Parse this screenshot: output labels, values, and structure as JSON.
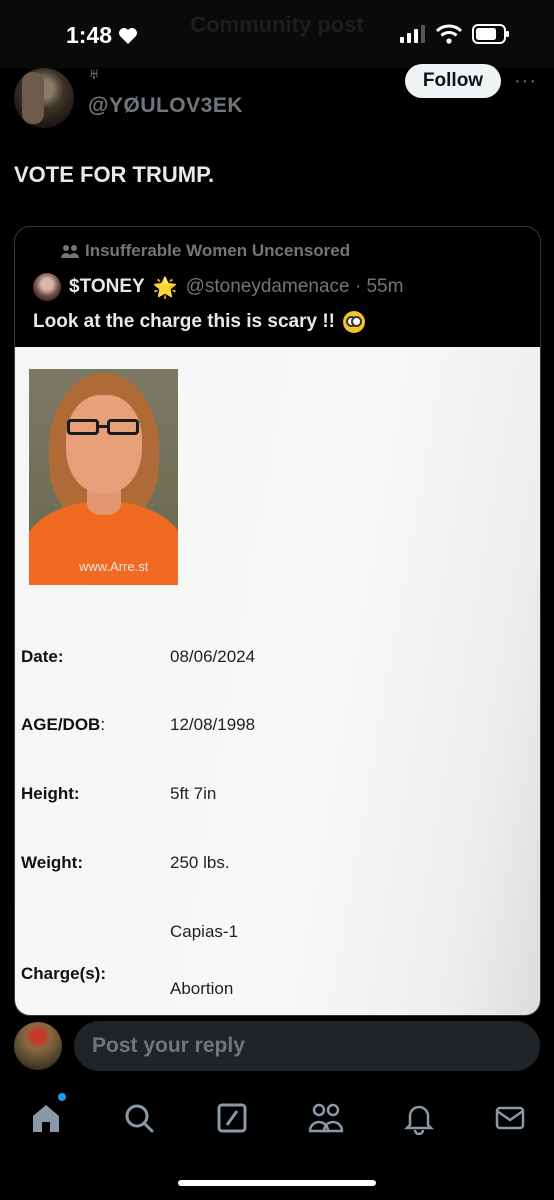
{
  "status_bar": {
    "time": "1:48",
    "ghost_title": "Community post"
  },
  "post": {
    "symbol": "♅",
    "handle": "@YØULOV3EK",
    "follow_label": "Follow",
    "more_label": "···",
    "text": "VOTE FOR TRUMP."
  },
  "quote": {
    "community": "Insufferable Women Uncensored",
    "display_name": "$TONEY",
    "star_emoji": "🌟",
    "username_time": "@stoneydamenace · 55m",
    "text": "Look at the charge this is scary !!",
    "media": {
      "watermark": "www.Arre.st",
      "rows": [
        {
          "label": "Date",
          "colon": ":",
          "value": "08/06/2024"
        },
        {
          "label": "AGE/DOB",
          "colon": ":",
          "value": "12/08/1998"
        },
        {
          "label": "Height",
          "colon": ":",
          "value": "5ft 7in"
        },
        {
          "label": "Weight",
          "colon": ":",
          "value": "250 lbs."
        }
      ],
      "charge": {
        "label": "Charge(s)",
        "colon": ":",
        "value1": "Capias-1",
        "value2": "Abortion"
      }
    }
  },
  "reply": {
    "placeholder": "Post your reply"
  },
  "nav": {
    "items": [
      "home-icon",
      "search-icon",
      "grok-icon",
      "communities-icon",
      "notifications-icon",
      "messages-icon"
    ],
    "accent": "#1d9bf0"
  }
}
